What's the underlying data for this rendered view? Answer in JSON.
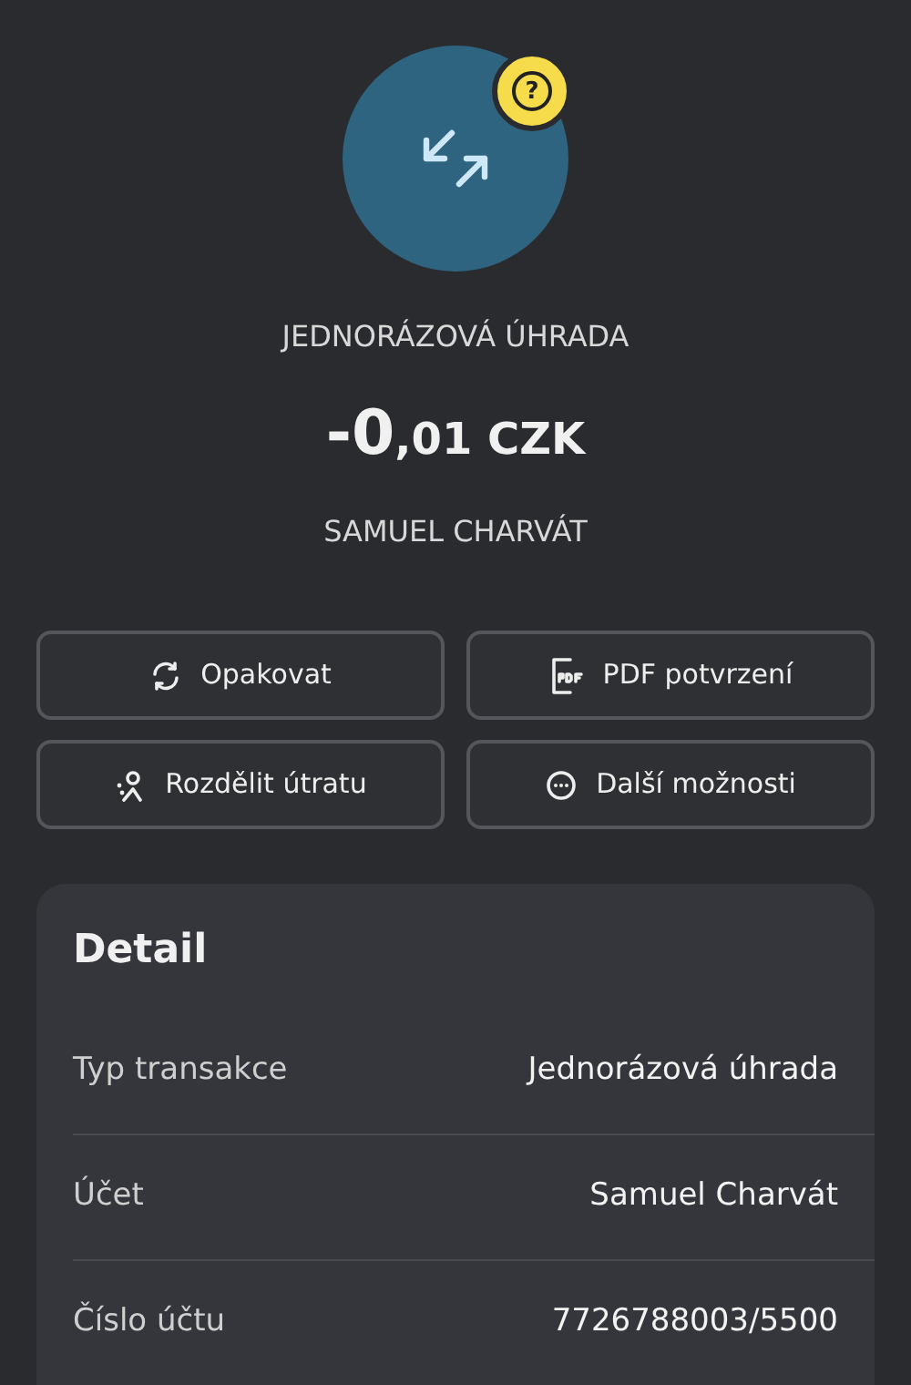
{
  "header": {
    "badge": "?",
    "type_label": "JEDNORÁZOVÁ ÚHRADA",
    "amount_major": "-0",
    "amount_minor": ",01 CZK",
    "counterparty": "SAMUEL CHARVÁT"
  },
  "actions": [
    {
      "kind": "repeat",
      "label": "Opakovat"
    },
    {
      "kind": "pdf",
      "label": "PDF potvrzení"
    },
    {
      "kind": "split",
      "label": "Rozdělit útratu"
    },
    {
      "kind": "more",
      "label": "Další možnosti"
    }
  ],
  "detail": {
    "title": "Detail",
    "rows": [
      {
        "label": "Typ transakce",
        "value": "Jednorázová úhrada"
      },
      {
        "label": "Účet",
        "value": "Samuel Charvát"
      },
      {
        "label": "Číslo účtu",
        "value": "7726788003/5500"
      }
    ]
  }
}
